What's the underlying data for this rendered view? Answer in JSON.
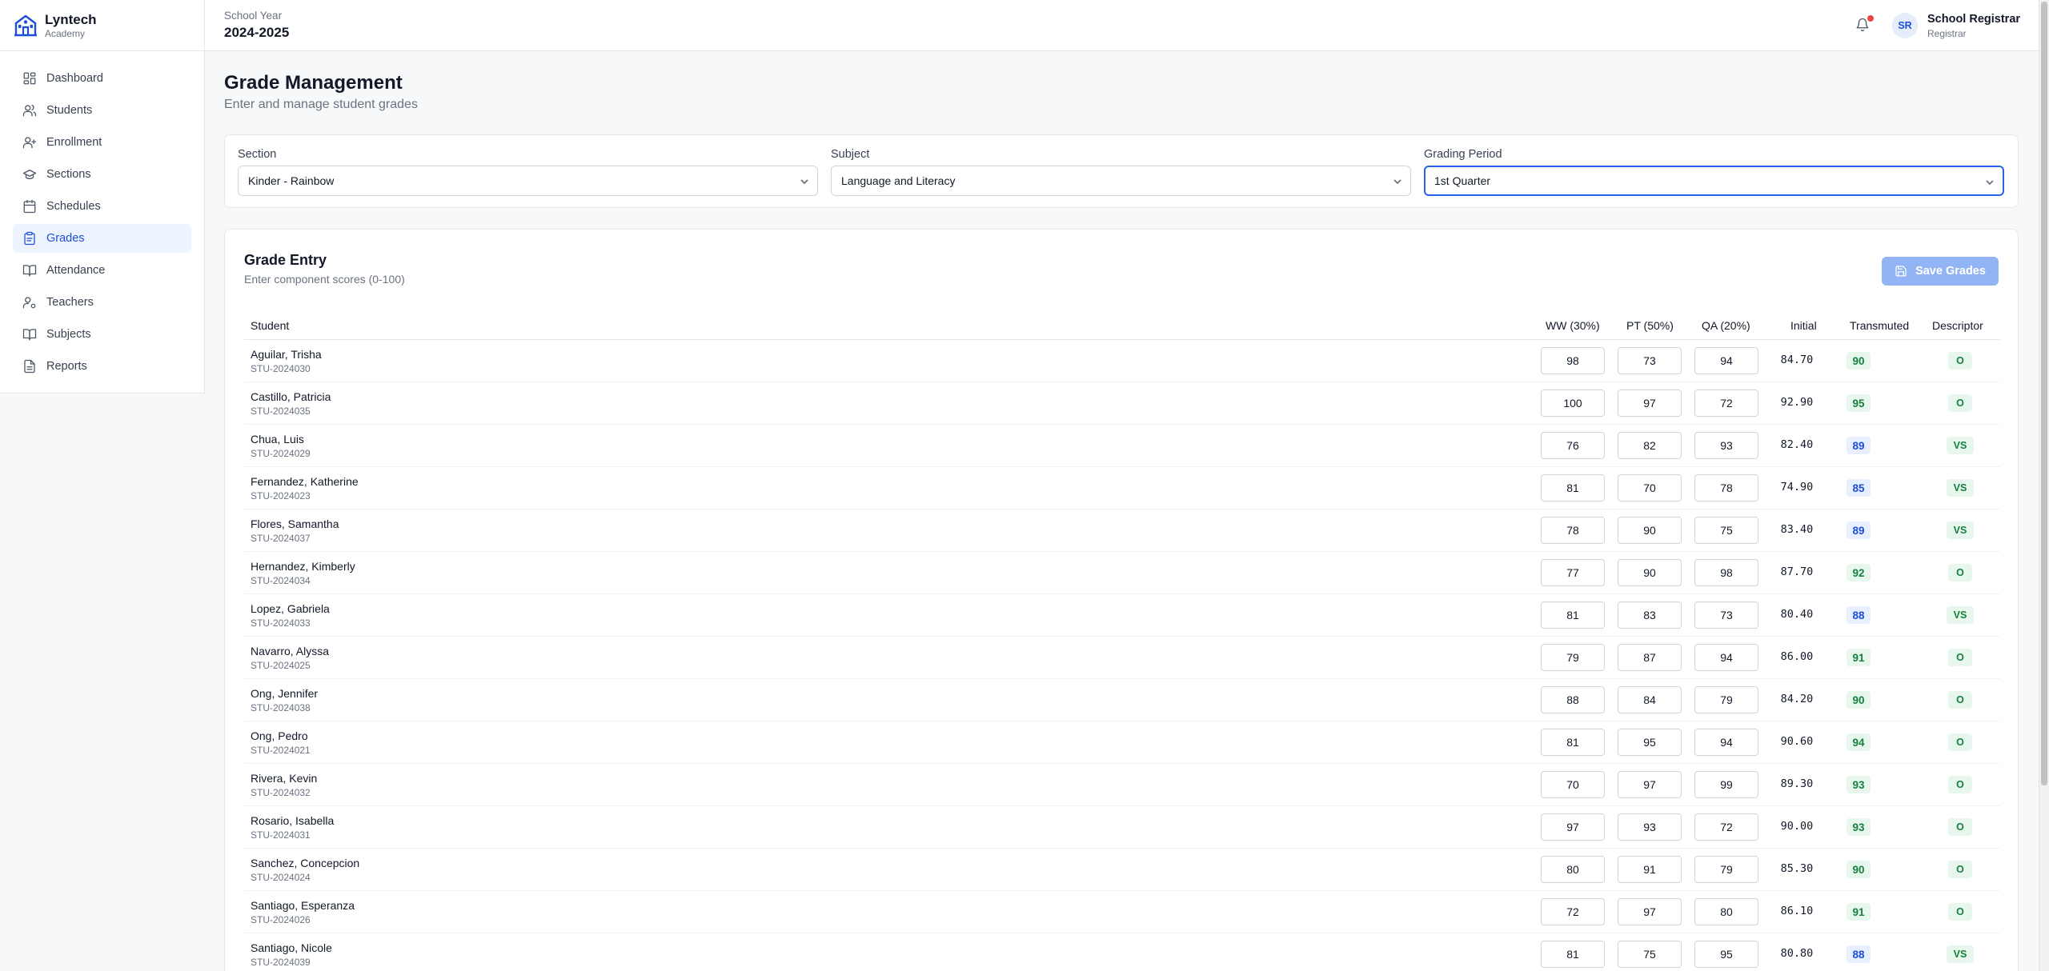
{
  "brand": {
    "name": "Lyntech",
    "sub": "Academy"
  },
  "nav": [
    {
      "key": "dashboard",
      "label": "Dashboard",
      "icon": "dashboard-icon",
      "active": false
    },
    {
      "key": "students",
      "label": "Students",
      "icon": "users-icon",
      "active": false
    },
    {
      "key": "enrollment",
      "label": "Enrollment",
      "icon": "user-plus-icon",
      "active": false
    },
    {
      "key": "sections",
      "label": "Sections",
      "icon": "graduation-cap-icon",
      "active": false
    },
    {
      "key": "schedules",
      "label": "Schedules",
      "icon": "calendar-icon",
      "active": false
    },
    {
      "key": "grades",
      "label": "Grades",
      "icon": "clipboard-icon",
      "active": true
    },
    {
      "key": "attendance",
      "label": "Attendance",
      "icon": "book-open-icon",
      "active": false
    },
    {
      "key": "teachers",
      "label": "Teachers",
      "icon": "user-cog-icon",
      "active": false
    },
    {
      "key": "subjects",
      "label": "Subjects",
      "icon": "book-icon",
      "active": false
    },
    {
      "key": "reports",
      "label": "Reports",
      "icon": "file-text-icon",
      "active": false
    }
  ],
  "header": {
    "school_year_label": "School Year",
    "school_year": "2024-2025",
    "avatar_initials": "SR",
    "user_name": "School Registrar",
    "user_role": "Registrar"
  },
  "page": {
    "title": "Grade Management",
    "subtitle": "Enter and manage student grades"
  },
  "filters": {
    "section": {
      "label": "Section",
      "value": "Kinder - Rainbow"
    },
    "subject": {
      "label": "Subject",
      "value": "Language and Literacy"
    },
    "period": {
      "label": "Grading Period",
      "value": "1st Quarter"
    }
  },
  "grade_entry": {
    "title": "Grade Entry",
    "subtitle": "Enter component scores (0-100)",
    "save_label": "Save Grades",
    "columns": {
      "student": "Student",
      "ww": "WW (30%)",
      "pt": "PT (50%)",
      "qa": "QA (20%)",
      "initial": "Initial",
      "transmuted": "Transmuted",
      "descriptor": "Descriptor"
    }
  },
  "colors": {
    "accent": "#2563eb",
    "save_disabled": "#93b4f4",
    "outstanding": "#15803d",
    "very_satisfactory": "#1d4ed8",
    "notification": "#ef4444"
  },
  "students": [
    {
      "name": "Aguilar, Trisha",
      "id": "STU-2024030",
      "ww": "98",
      "pt": "73",
      "qa": "94",
      "initial": "84.70",
      "transmuted": "90",
      "descriptor": "O"
    },
    {
      "name": "Castillo, Patricia",
      "id": "STU-2024035",
      "ww": "100",
      "pt": "97",
      "qa": "72",
      "initial": "92.90",
      "transmuted": "95",
      "descriptor": "O"
    },
    {
      "name": "Chua, Luis",
      "id": "STU-2024029",
      "ww": "76",
      "pt": "82",
      "qa": "93",
      "initial": "82.40",
      "transmuted": "89",
      "descriptor": "VS"
    },
    {
      "name": "Fernandez, Katherine",
      "id": "STU-2024023",
      "ww": "81",
      "pt": "70",
      "qa": "78",
      "initial": "74.90",
      "transmuted": "85",
      "descriptor": "VS"
    },
    {
      "name": "Flores, Samantha",
      "id": "STU-2024037",
      "ww": "78",
      "pt": "90",
      "qa": "75",
      "initial": "83.40",
      "transmuted": "89",
      "descriptor": "VS"
    },
    {
      "name": "Hernandez, Kimberly",
      "id": "STU-2024034",
      "ww": "77",
      "pt": "90",
      "qa": "98",
      "initial": "87.70",
      "transmuted": "92",
      "descriptor": "O"
    },
    {
      "name": "Lopez, Gabriela",
      "id": "STU-2024033",
      "ww": "81",
      "pt": "83",
      "qa": "73",
      "initial": "80.40",
      "transmuted": "88",
      "descriptor": "VS"
    },
    {
      "name": "Navarro, Alyssa",
      "id": "STU-2024025",
      "ww": "79",
      "pt": "87",
      "qa": "94",
      "initial": "86.00",
      "transmuted": "91",
      "descriptor": "O"
    },
    {
      "name": "Ong, Jennifer",
      "id": "STU-2024038",
      "ww": "88",
      "pt": "84",
      "qa": "79",
      "initial": "84.20",
      "transmuted": "90",
      "descriptor": "O"
    },
    {
      "name": "Ong, Pedro",
      "id": "STU-2024021",
      "ww": "81",
      "pt": "95",
      "qa": "94",
      "initial": "90.60",
      "transmuted": "94",
      "descriptor": "O"
    },
    {
      "name": "Rivera, Kevin",
      "id": "STU-2024032",
      "ww": "70",
      "pt": "97",
      "qa": "99",
      "initial": "89.30",
      "transmuted": "93",
      "descriptor": "O"
    },
    {
      "name": "Rosario, Isabella",
      "id": "STU-2024031",
      "ww": "97",
      "pt": "93",
      "qa": "72",
      "initial": "90.00",
      "transmuted": "93",
      "descriptor": "O"
    },
    {
      "name": "Sanchez, Concepcion",
      "id": "STU-2024024",
      "ww": "80",
      "pt": "91",
      "qa": "79",
      "initial": "85.30",
      "transmuted": "90",
      "descriptor": "O"
    },
    {
      "name": "Santiago, Esperanza",
      "id": "STU-2024026",
      "ww": "72",
      "pt": "97",
      "qa": "80",
      "initial": "86.10",
      "transmuted": "91",
      "descriptor": "O"
    },
    {
      "name": "Santiago, Nicole",
      "id": "STU-2024039",
      "ww": "81",
      "pt": "75",
      "qa": "95",
      "initial": "80.80",
      "transmuted": "88",
      "descriptor": "VS"
    }
  ]
}
